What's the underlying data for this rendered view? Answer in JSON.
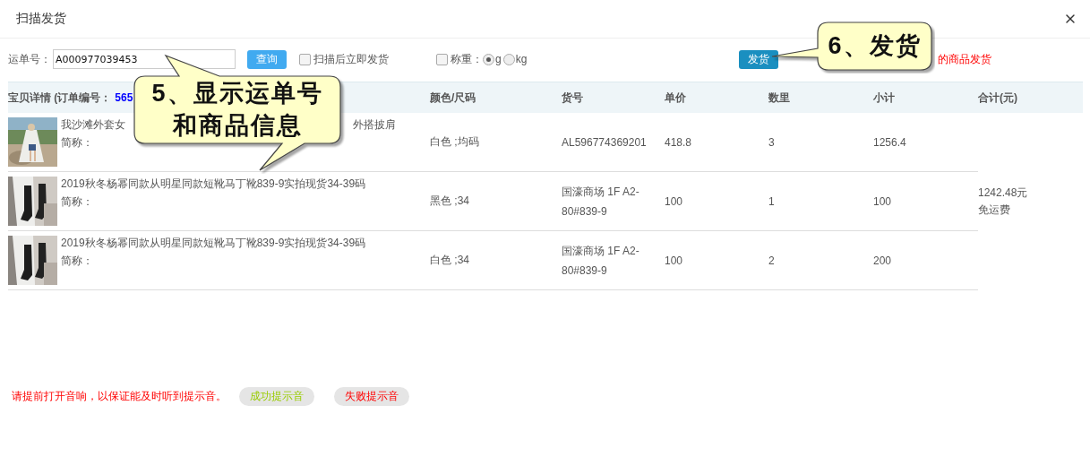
{
  "window": {
    "title": "扫描发货"
  },
  "toolbar": {
    "waybill_label": "运单号：",
    "waybill_value": "A000977039453",
    "query_button": "查询",
    "auto_ship": {
      "label": "扫描后立即发货",
      "checked": false
    },
    "weigh": {
      "label": "称重：",
      "checked": false
    },
    "units": [
      {
        "label": "g",
        "selected": true
      },
      {
        "label": "kg",
        "selected": false
      }
    ],
    "ship_button": "发货",
    "notice": "的商品发货"
  },
  "table": {
    "detail_header": "宝贝详情 (订单编号：",
    "order_no": "565",
    "columns": [
      "颜色/尺码",
      "货号",
      "单价",
      "数里",
      "小计",
      "合计(元)"
    ],
    "rows": [
      {
        "photo": {
          "kind": "picture"
        },
        "title_parts": [
          "我沙滩外套女",
          "外搭披肩"
        ],
        "alias": "简称：",
        "variant": "白色 ;均码",
        "sku": "AL596774369201",
        "price": "418.8",
        "qty": "3",
        "subtotal": "1256.4"
      },
      {
        "photo": {
          "kind": "picture"
        },
        "title_parts": [
          "2019秋冬杨幂同款从明星同款短靴马丁靴839-9实拍现货34-39码"
        ],
        "alias": "简称：",
        "variant": "黑色 ;34",
        "sku": "国濠商场 1F A2-80#839-9",
        "price": "100",
        "qty": "1",
        "subtotal": "100"
      },
      {
        "photo": {
          "kind": "picture"
        },
        "title_parts": [
          "2019秋冬杨幂同款从明星同款短靴马丁靴839-9实拍现货34-39码"
        ],
        "alias": "简称：",
        "variant": "白色 ;34",
        "sku": "国濠商场 1F A2-80#839-9",
        "price": "100",
        "qty": "2",
        "subtotal": "200"
      }
    ],
    "total": {
      "amount": "1242.48元",
      "shipping": "免运费"
    }
  },
  "footer": {
    "notice": "请提前打开音响，以保证能及时听到提示音。",
    "sounds": [
      {
        "kind": "success",
        "label": "成功提示音"
      },
      {
        "kind": "failure",
        "label": "失败提示音"
      }
    ]
  },
  "callouts": [
    {
      "kind": "two-tail",
      "lines": [
        "5、显示运单号",
        "和商品信息"
      ]
    },
    {
      "kind": "left-tail",
      "lines": [
        "6、发货"
      ]
    }
  ]
}
